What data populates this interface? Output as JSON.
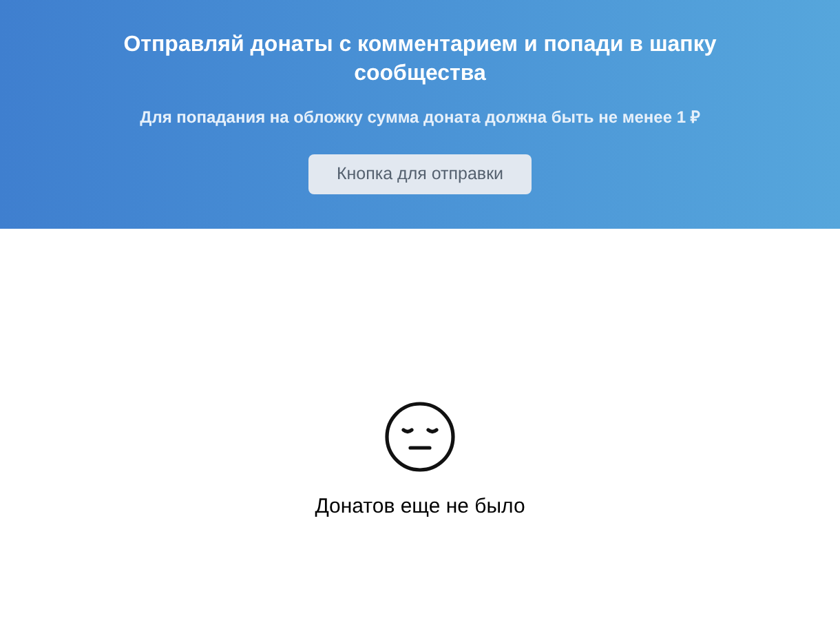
{
  "banner": {
    "title": "Отправляй донаты с комментарием и попади в шапку сообщества",
    "subtitle": "Для попадания на обложку сумма доната должна быть не менее 1 ₽",
    "button": "Кнопка для отправки"
  },
  "empty_state": {
    "message": "Донатов еще не было"
  }
}
